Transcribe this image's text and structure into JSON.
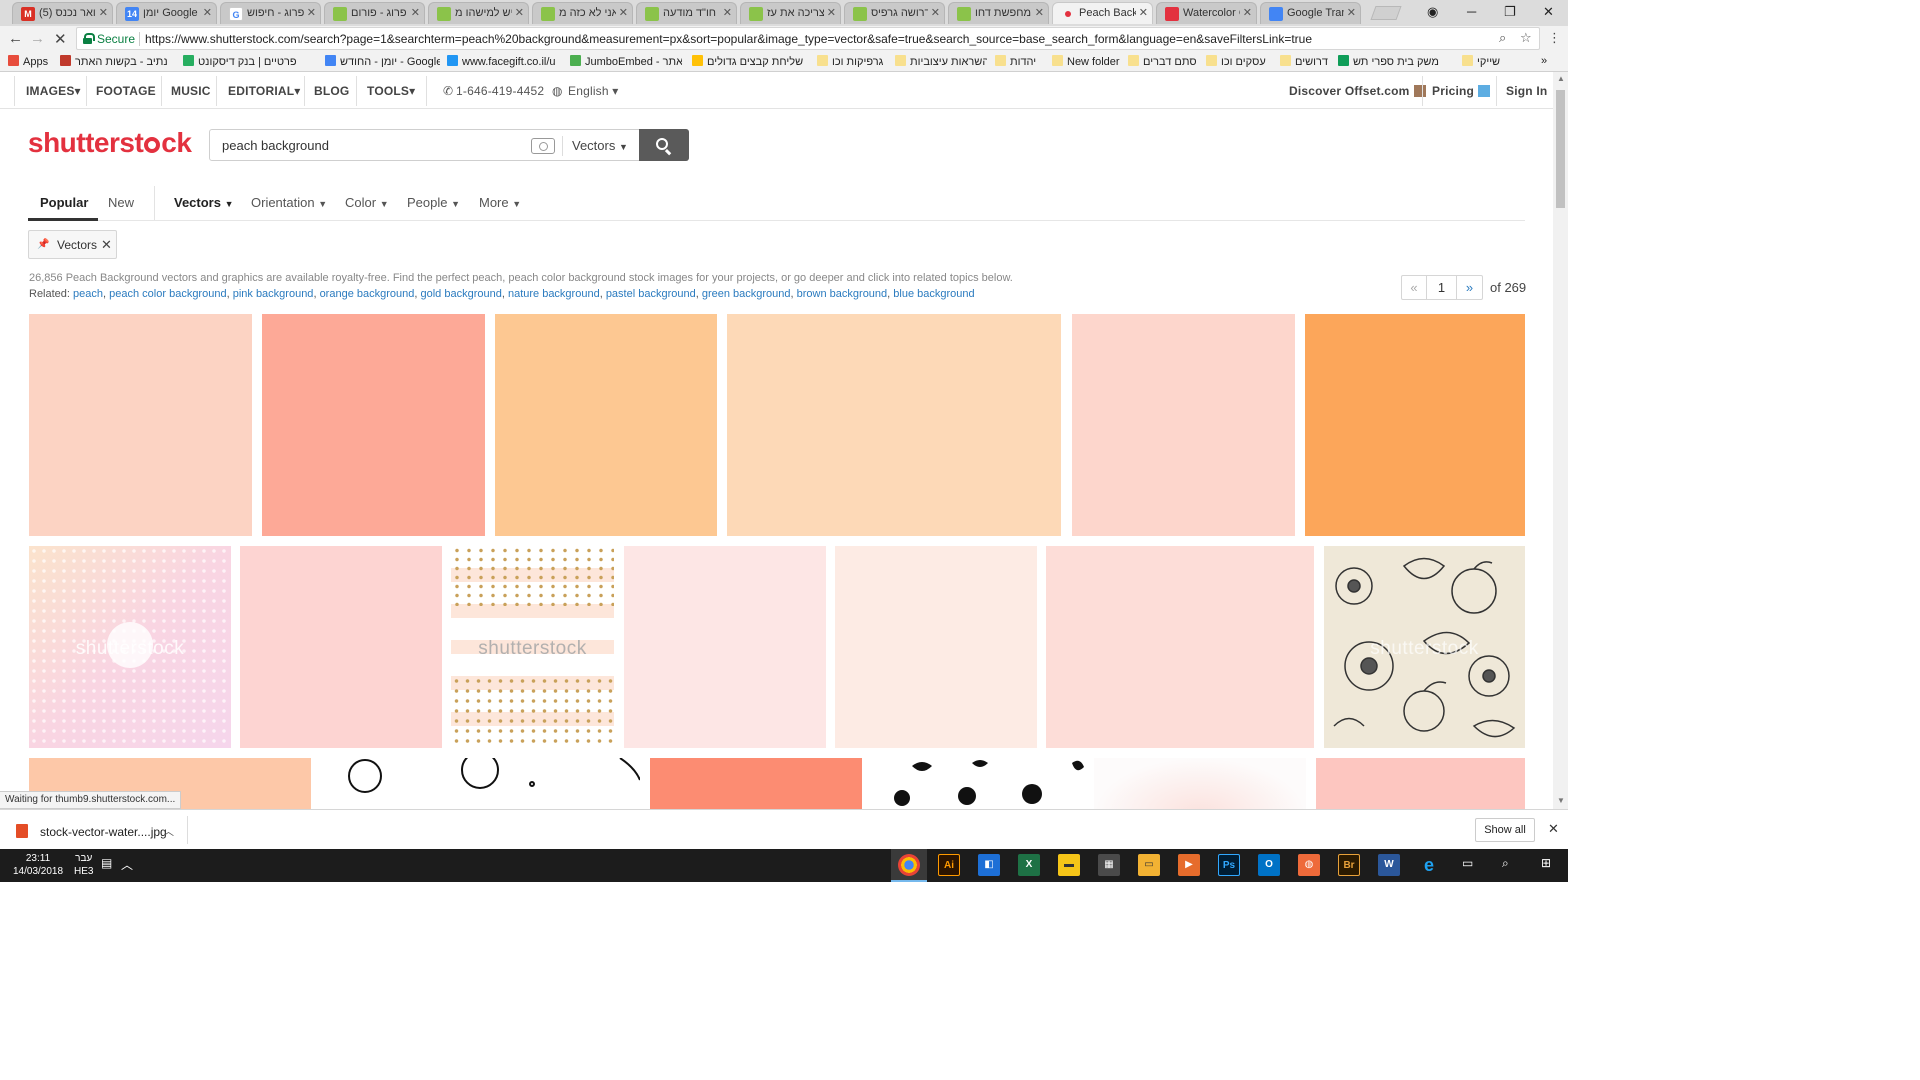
{
  "browser": {
    "tabs": [
      {
        "title": "דואר נכנס (5) - ail",
        "color": "#d93025",
        "glyph": "M"
      },
      {
        "title": "יומן Google",
        "color": "#4285f4",
        "glyph": "14"
      },
      {
        "title": "פרוג - חיפוש",
        "color": "#4285f4",
        "glyph": "G"
      },
      {
        "title": "פרוג - פורום",
        "color": "#8bc34a",
        "glyph": ""
      },
      {
        "title": "יש למישהו מ",
        "color": "#8bc34a",
        "glyph": ""
      },
      {
        "title": "אני לא כזה מ",
        "color": "#8bc34a",
        "glyph": ""
      },
      {
        "title": "חו\"ד מודעה",
        "color": "#8bc34a",
        "glyph": ""
      },
      {
        "title": "צריכה את עז",
        "color": "#8bc34a",
        "glyph": ""
      },
      {
        "title": "דרושה גרפיס",
        "color": "#8bc34a",
        "glyph": ""
      },
      {
        "title": "מחפשת דחו",
        "color": "#8bc34a",
        "glyph": ""
      },
      {
        "title": "Peach Backg",
        "color": "#e3313f",
        "glyph": ""
      },
      {
        "title": "Watercolor C",
        "color": "#e3313f",
        "glyph": ""
      },
      {
        "title": "Google Tran",
        "color": "#4285f4",
        "glyph": ""
      }
    ],
    "secure_label": "Secure",
    "url": "https://www.shutterstock.com/search?page=1&searchterm=peach%20background&measurement=px&sort=popular&image_type=vector&safe=true&search_source=base_search_form&language=en&saveFiltersLink=true",
    "bookmarks": [
      {
        "label": "Apps",
        "color": "#e74c3c"
      },
      {
        "label": "נתיב - בקשות האתר",
        "color": "#c0392b"
      },
      {
        "label": "פרטיים | בנק דיסקונט",
        "color": "#27ae60"
      },
      {
        "label": "יומן - החודש - Google",
        "color": "#4285f4"
      },
      {
        "label": "www.facegift.co.il/u",
        "color": "#2196f3"
      },
      {
        "label": "JumboEmbed - אתר",
        "color": "#4caf50"
      },
      {
        "label": "שליחת קבצים גדולים",
        "color": "#ffc107"
      },
      {
        "label": "גרפיקות וכו",
        "color": "#f8e08e"
      },
      {
        "label": "השראות עיצוביות",
        "color": "#f8e08e"
      },
      {
        "label": "יהדות",
        "color": "#f8e08e"
      },
      {
        "label": "New folder",
        "color": "#f8e08e"
      },
      {
        "label": "סתם דברים",
        "color": "#f8e08e"
      },
      {
        "label": "עסקים וכו",
        "color": "#f8e08e"
      },
      {
        "label": "דרושים",
        "color": "#f8e08e"
      },
      {
        "label": "משק בית ספרי תש",
        "color": "#0f9d58"
      },
      {
        "label": "שייקי",
        "color": "#f8e08e"
      }
    ]
  },
  "site_nav": {
    "images": "IMAGES▾",
    "footage": "FOOTAGE",
    "music": "MUSIC",
    "editorial": "EDITORIAL▾",
    "blog": "BLOG",
    "tools": "TOOLS▾",
    "phone": "1-646-419-4452",
    "language": "English ▾",
    "offset": "Discover Offset.com",
    "pricing": "Pricing",
    "signin": "Sign In",
    "offset_color": "#a0785a",
    "pricing_color": "#5dade2"
  },
  "logo": {
    "part1": "shutterst",
    "part2": "ck"
  },
  "search": {
    "value": "peach background",
    "type": "Vectors"
  },
  "filters": {
    "popular": "Popular",
    "new": "New",
    "vectors": "Vectors",
    "orientation": "Orientation",
    "color": "Color",
    "people": "People",
    "more": "More"
  },
  "active_filter": "Vectors",
  "results": {
    "description": "26,856 Peach Background vectors and graphics are available royalty-free. Find the perfect peach, peach color background stock images for your projects, or go deeper and click into related topics below.",
    "related_label": "Related:",
    "related": [
      "peach",
      "peach color background",
      "pink background",
      "orange background",
      "gold background",
      "nature background",
      "pastel background",
      "green background",
      "brown background",
      "blue background"
    ],
    "pagination": {
      "prev": "«",
      "current": "1",
      "next": "»",
      "of": "of 269"
    },
    "watermark": "shutterstock",
    "tile_colors": [
      "#fcd3c3",
      "#fda997",
      "#fdc892",
      "#fdd9b7",
      "#fdd6cc",
      "#fca65a",
      "#f9d7dc",
      "#fdd4d2",
      "#fbf6f3",
      "#fde6e5",
      "#fdebe4",
      "#fdddd8",
      "#efe8d8",
      "#fdc8a8",
      "#ffffff",
      "#fc8c72",
      "#ffffff",
      "#fdfbfb",
      "#fdc6c0"
    ]
  },
  "status": "Waiting for thumb9.shutterstock.com...",
  "downloads": {
    "file": "stock-vector-water....jpg",
    "show_all": "Show all"
  },
  "taskbar": {
    "time": "23:11",
    "date": "14/03/2018",
    "lang1": "עבר",
    "lang2": "HE3"
  }
}
